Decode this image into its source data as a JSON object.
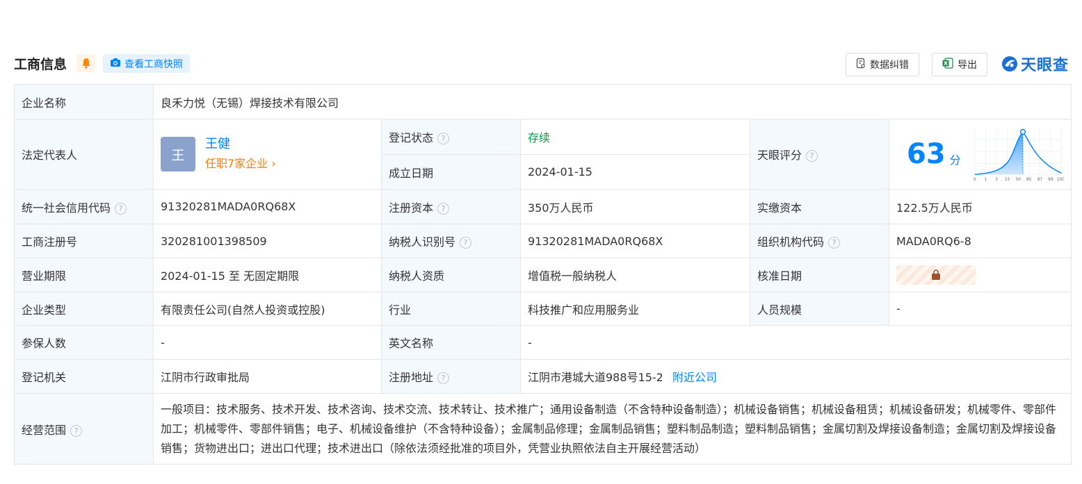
{
  "header": {
    "title": "工商信息",
    "snapshot_btn": "查看工商快照",
    "correct_btn": "数据纠错",
    "export_btn": "导出",
    "logo": "天眼查"
  },
  "rows": {
    "company_name": {
      "label": "企业名称",
      "value": "良禾力悦（无锡）焊接技术有限公司"
    },
    "legal_rep": {
      "label": "法定代表人",
      "avatar_char": "王",
      "name": "王健",
      "positions": "任职7家企业 ›"
    },
    "reg_status": {
      "label": "登记状态",
      "value": "存续"
    },
    "founded": {
      "label": "成立日期",
      "value": "2024-01-15"
    },
    "tianyan_score": {
      "label": "天眼评分",
      "score": "63",
      "unit": "分",
      "chart_ticks": [
        "0",
        "1",
        "3",
        "15",
        "50",
        "85",
        "97",
        "99",
        "100"
      ]
    },
    "credit_code": {
      "label": "统一社会信用代码",
      "value": "91320281MADA0RQ68X"
    },
    "reg_capital": {
      "label": "注册资本",
      "value": "350万人民币"
    },
    "paid_capital": {
      "label": "实缴资本",
      "value": "122.5万人民币"
    },
    "biz_reg_no": {
      "label": "工商注册号",
      "value": "320281001398509"
    },
    "taxpayer_id": {
      "label": "纳税人识别号",
      "value": "91320281MADA0RQ68X"
    },
    "org_code": {
      "label": "组织机构代码",
      "value": "MADA0RQ6-8"
    },
    "term": {
      "label": "营业期限",
      "value": "2024-01-15 至 无固定期限"
    },
    "taxpayer_qual": {
      "label": "纳税人资质",
      "value": "增值税一般纳税人"
    },
    "approval_date": {
      "label": "核准日期"
    },
    "company_type": {
      "label": "企业类型",
      "value": "有限责任公司(自然人投资或控股)"
    },
    "industry": {
      "label": "行业",
      "value": "科技推广和应用服务业"
    },
    "staff_size": {
      "label": "人员规模",
      "value": "-"
    },
    "insured": {
      "label": "参保人数",
      "value": "-"
    },
    "english_name": {
      "label": "英文名称",
      "value": "-"
    },
    "reg_authority": {
      "label": "登记机关",
      "value": "江阴市行政审批局"
    },
    "reg_address": {
      "label": "注册地址",
      "value": "江阴市港城大道988号15-2",
      "nearby": "附近公司"
    },
    "biz_scope": {
      "label": "经营范围",
      "value": "一般项目：技术服务、技术开发、技术咨询、技术交流、技术转让、技术推广；通用设备制造（不含特种设备制造）；机械设备销售；机械设备租赁；机械设备研发；机械零件、零部件加工；机械零件、零部件销售；电子、机械设备维护（不含特种设备）；金属制品修理；金属制品销售；塑料制品制造；塑料制品销售；金属切割及焊接设备制造；金属切割及焊接设备销售；货物进出口；进出口代理；技术进出口（除依法须经批准的项目外，凭营业执照依法自主开展经营活动）"
    }
  },
  "colors": {
    "accent": "#0084ff",
    "status_green": "#009944",
    "orange": "#ff7b00",
    "label_bg": "#f4f8ff"
  }
}
